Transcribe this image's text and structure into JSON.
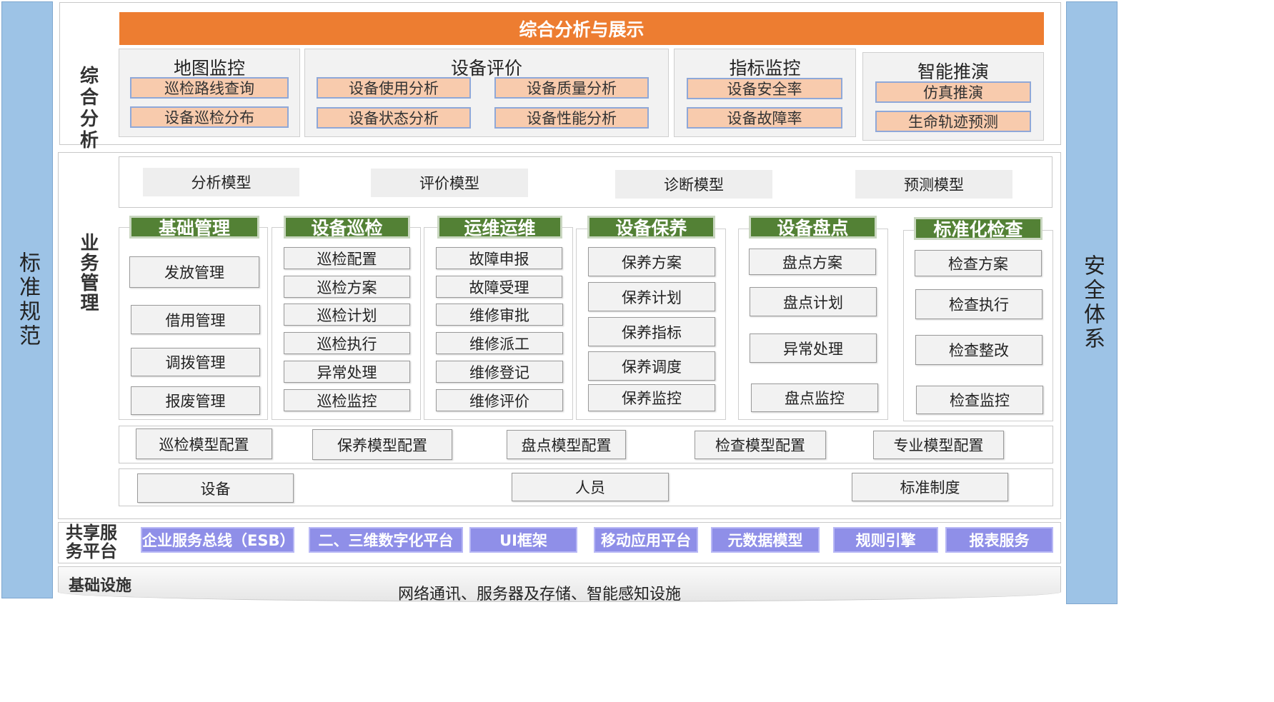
{
  "left_pillar": "标准规范",
  "right_pillar": "安全体系",
  "analysis": {
    "label": "综合分析",
    "banner": "综合分析与展示",
    "groups": [
      {
        "title": "地图监控",
        "items": [
          "巡检路线查询",
          "设备巡检分布"
        ]
      },
      {
        "title": "设备评价",
        "items": [
          "设备使用分析",
          "设备质量分析",
          "设备状态分析",
          "设备性能分析"
        ]
      },
      {
        "title": "指标监控",
        "items": [
          "设备安全率",
          "设备故障率"
        ]
      },
      {
        "title": "智能推演",
        "items": [
          "仿真推演",
          "生命轨迹预测"
        ]
      }
    ]
  },
  "business": {
    "label": "业务管理",
    "models": [
      "分析模型",
      "评价模型",
      "诊断模型",
      "预测模型"
    ],
    "columns": [
      {
        "header": "基础管理",
        "items": [
          "发放管理",
          "借用管理",
          "调拨管理",
          "报废管理"
        ]
      },
      {
        "header": "设备巡检",
        "items": [
          "巡检配置",
          "巡检方案",
          "巡检计划",
          "巡检执行",
          "异常处理",
          "巡检监控"
        ]
      },
      {
        "header": "运维运维",
        "items": [
          "故障申报",
          "故障受理",
          "维修审批",
          "维修派工",
          "维修登记",
          "维修评价"
        ]
      },
      {
        "header": "设备保养",
        "items": [
          "保养方案",
          "保养计划",
          "保养指标",
          "保养调度",
          "保养监控"
        ]
      },
      {
        "header": "设备盘点",
        "items": [
          "盘点方案",
          "盘点计划",
          "异常处理",
          "盘点监控"
        ]
      },
      {
        "header": "标准化检查",
        "items": [
          "检查方案",
          "检查执行",
          "检查整改",
          "检查监控"
        ]
      }
    ],
    "configs": [
      "巡检模型配置",
      "保养模型配置",
      "盘点模型配置",
      "检查模型配置",
      "专业模型配置"
    ],
    "base": [
      "设备",
      "人员",
      "标准制度"
    ]
  },
  "shared": {
    "label_line1": "共享服",
    "label_line2": "务平台",
    "items": [
      "企业服务总线（ESB）",
      "二、三维数字化平台",
      "UI框架",
      "移动应用平台",
      "元数据模型",
      "规则引擎",
      "报表服务"
    ]
  },
  "infra": {
    "label": "基础设施",
    "text": "网络通讯、服务器及存储、智能感知设施"
  },
  "colors": {
    "banner": "#ed7d31",
    "item_orange": "#f8cbad",
    "header_green": "#538135",
    "shared_purple": "#8f8fe8",
    "pillar_blue": "#9dc3e6"
  }
}
